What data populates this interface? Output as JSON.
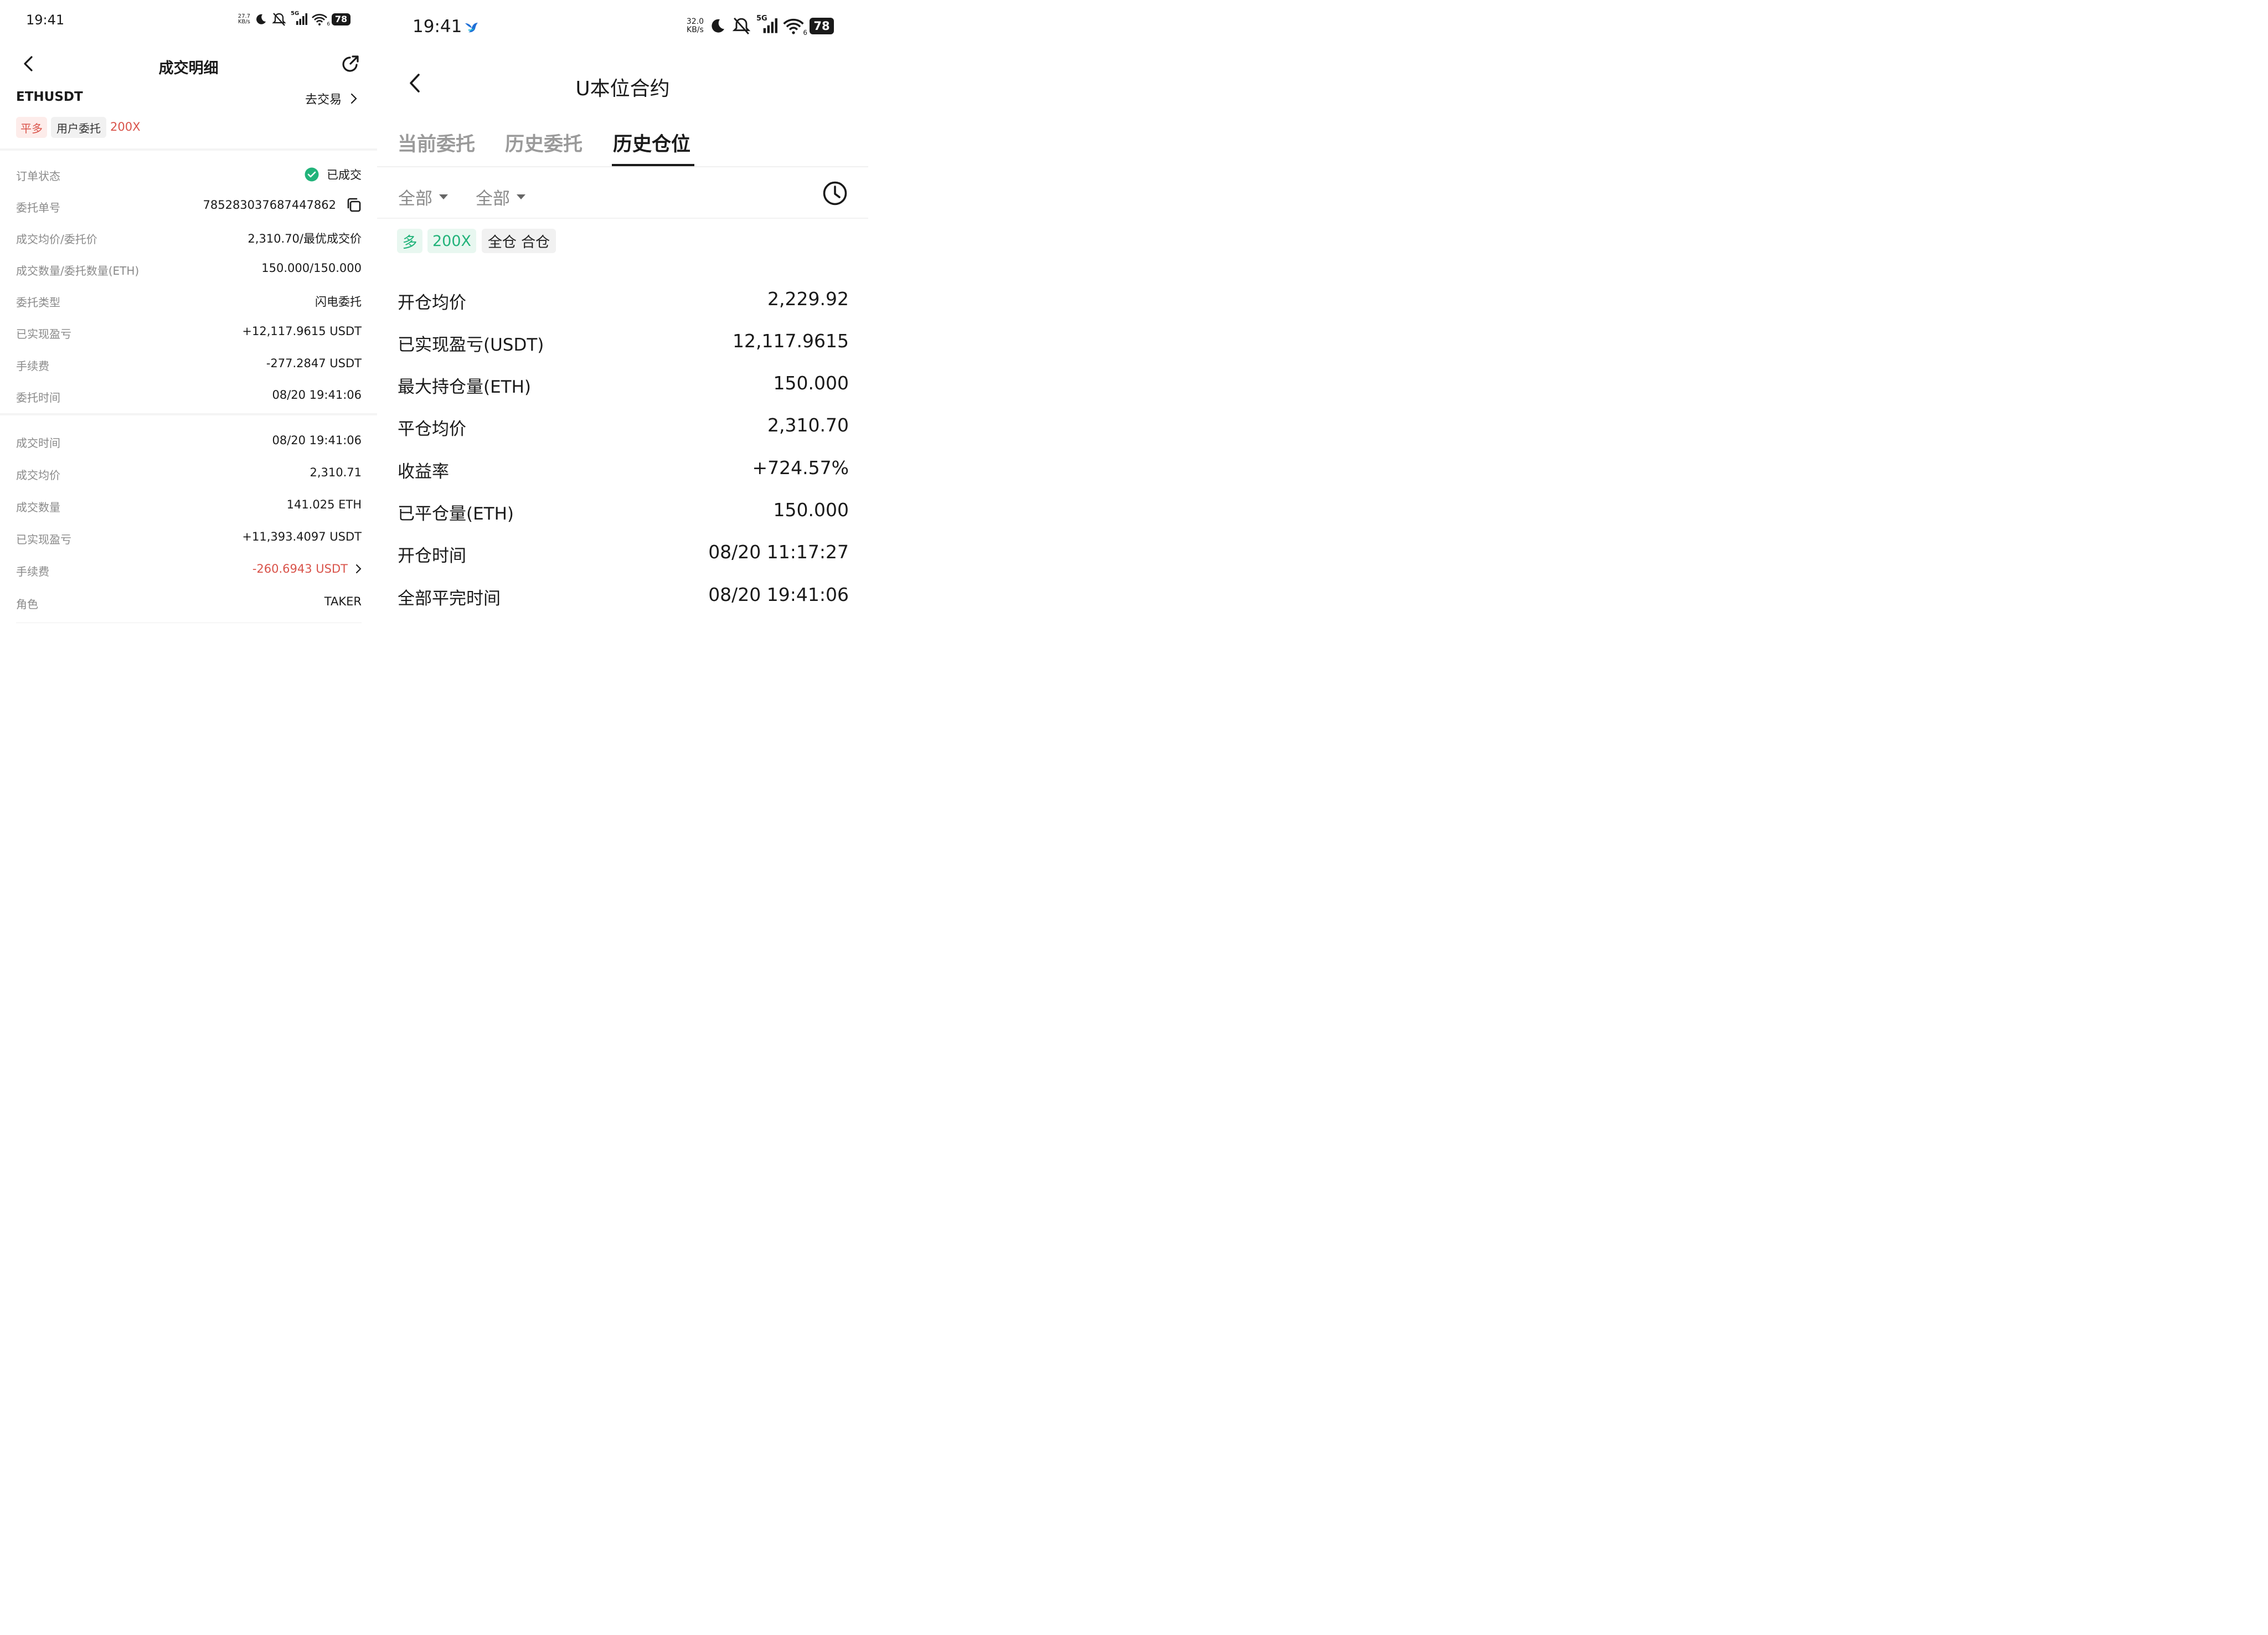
{
  "left": {
    "status_bar": {
      "time": "19:41",
      "speed_value": "27.7",
      "speed_unit": "KB/s",
      "signal": "5G",
      "wifi_sub": "6",
      "battery": "78"
    },
    "header": {
      "title": "成交明细"
    },
    "pair": {
      "symbol": "ETHUSDT",
      "trade_link": "去交易"
    },
    "tags": {
      "direction": "平多",
      "order_type": "用户委托",
      "leverage": "200X"
    },
    "order_rows": [
      {
        "label": "订单状态",
        "value": "已成交"
      },
      {
        "label": "委托单号",
        "value": "785283037687447862"
      },
      {
        "label": "成交均价/委托价",
        "value": "2,310.70/最优成交价"
      },
      {
        "label": "成交数量/委托数量(ETH)",
        "value": "150.000/150.000"
      },
      {
        "label": "委托类型",
        "value": "闪电委托"
      },
      {
        "label": "已实现盈亏",
        "value": "+12,117.9615 USDT"
      },
      {
        "label": "手续费",
        "value": "-277.2847 USDT"
      },
      {
        "label": "委托时间",
        "value": "08/20 19:41:06"
      }
    ],
    "fill_rows": [
      {
        "label": "成交时间",
        "value": "08/20 19:41:06"
      },
      {
        "label": "成交均价",
        "value": "2,310.71"
      },
      {
        "label": "成交数量",
        "value": "141.025 ETH"
      },
      {
        "label": "已实现盈亏",
        "value": "+11,393.4097 USDT"
      },
      {
        "label": "手续费",
        "value": "-260.6943 USDT"
      },
      {
        "label": "角色",
        "value": "TAKER"
      }
    ]
  },
  "right": {
    "status_bar": {
      "time": "19:41",
      "speed_value": "32.0",
      "speed_unit": "KB/s",
      "signal": "5G",
      "wifi_sub": "6",
      "battery": "78"
    },
    "header": {
      "title": "U本位合约"
    },
    "tabs": [
      {
        "label": "当前委托",
        "active": false
      },
      {
        "label": "历史委托",
        "active": false
      },
      {
        "label": "历史仓位",
        "active": true
      }
    ],
    "filters": [
      {
        "label": "全部"
      },
      {
        "label": "全部"
      }
    ],
    "tags": {
      "side": "多",
      "leverage": "200X",
      "margin_mode": "全仓 合仓"
    },
    "rows": [
      {
        "label": "开仓均价",
        "value": "2,229.92"
      },
      {
        "label": "已实现盈亏(USDT)",
        "value": "12,117.9615"
      },
      {
        "label": "最大持仓量(ETH)",
        "value": "150.000"
      },
      {
        "label": "平仓均价",
        "value": "2,310.70"
      },
      {
        "label": "收益率",
        "value": "+724.57%"
      },
      {
        "label": "已平仓量(ETH)",
        "value": "150.000"
      },
      {
        "label": "开仓时间",
        "value": "08/20 11:17:27"
      },
      {
        "label": "全部平完时间",
        "value": "08/20 19:41:06"
      }
    ]
  },
  "colors": {
    "profit_green": "#21b37a",
    "loss_red": "#d9534a",
    "label_grey": "#8a8a8a",
    "tag_red_bg": "#fdecea",
    "tag_green_bg": "#e8f7f0",
    "tag_grey_bg": "#f1f1f1"
  },
  "icons": [
    "back-arrow-icon",
    "share-icon",
    "chevron-right-icon",
    "check-circle-icon",
    "copy-icon",
    "moon-icon",
    "mute-bell-icon",
    "signal-icon",
    "wifi-icon",
    "battery-icon",
    "bird-logo-icon",
    "clock-icon",
    "dropdown-triangle-icon"
  ]
}
